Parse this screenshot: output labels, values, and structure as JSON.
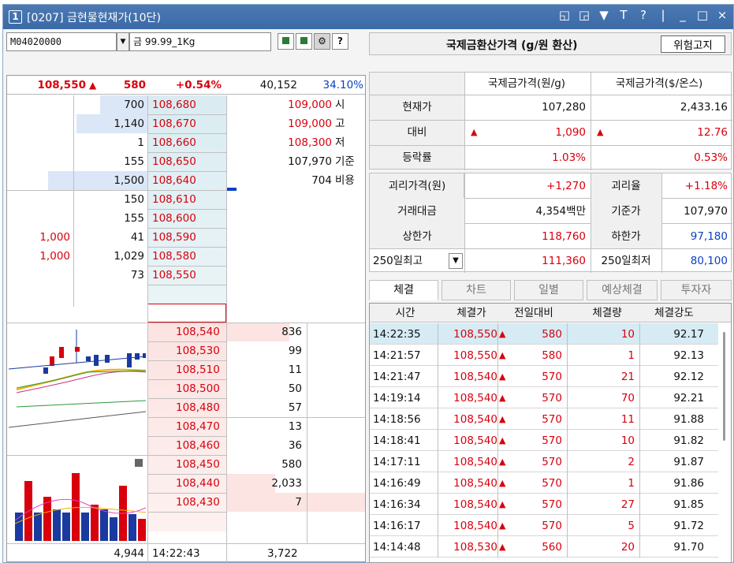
{
  "window": {
    "number": "1",
    "title": "[0207] 금현물현재가(10단)",
    "title_icons": [
      "restore-icon",
      "new-window-icon",
      "pin-icon",
      "text-icon",
      "help-icon",
      "separator",
      "minimize-icon",
      "maximize-icon",
      "close-icon"
    ],
    "title_icon_glyphs": [
      "◱",
      "◲",
      "▼",
      "T",
      "?",
      "|",
      "_",
      "□",
      "×"
    ]
  },
  "controls": {
    "code": "M04020000",
    "name": "금 99.99_1Kg",
    "icons": [
      "chart-small-icon",
      "chart-small-icon-2",
      "gear-icon",
      "help-icon"
    ],
    "icon_glyphs": [
      "▪",
      "▪",
      "⚙",
      "?"
    ]
  },
  "summary": {
    "price": "108,550",
    "change": "580",
    "change_pct": "+0.54%",
    "volume": "40,152",
    "rate": "34.10%"
  },
  "asks": [
    {
      "qty": "700",
      "price": "108,680"
    },
    {
      "qty": "1,140",
      "price": "108,670"
    },
    {
      "qty": "1",
      "price": "108,660"
    },
    {
      "qty": "155",
      "price": "108,650"
    },
    {
      "qty": "1,500",
      "price": "108,640"
    },
    {
      "qty": "150",
      "price": "108,610"
    },
    {
      "qty": "155",
      "price": "108,600"
    },
    {
      "qty": "41",
      "price": "108,590",
      "side": "1,000"
    },
    {
      "qty": "1,029",
      "price": "108,580",
      "side": "1,000"
    },
    {
      "qty": "73",
      "price": "108,550"
    }
  ],
  "ask_info": [
    {
      "value": "109,000",
      "label": "시"
    },
    {
      "value": "109,000",
      "label": "고"
    },
    {
      "value": "108,300",
      "label": "저"
    },
    {
      "value": "107,970",
      "label": "기준"
    },
    {
      "value": "704",
      "label": "비용"
    }
  ],
  "bids": [
    {
      "price": "108,540",
      "qty": "836"
    },
    {
      "price": "108,530",
      "qty": "99"
    },
    {
      "price": "108,510",
      "qty": "11"
    },
    {
      "price": "108,500",
      "qty": "50"
    },
    {
      "price": "108,480",
      "qty": "57"
    },
    {
      "price": "108,470",
      "qty": "13"
    },
    {
      "price": "108,460",
      "qty": "36"
    },
    {
      "price": "108,450",
      "qty": "580"
    },
    {
      "price": "108,440",
      "qty": "2,033"
    },
    {
      "price": "108,430",
      "qty": "7"
    }
  ],
  "footer": {
    "ask_total": "4,944",
    "time": "14:22:43",
    "bid_total": "3,722"
  },
  "intl": {
    "title": "국제금환산가격 (g/원 환산)",
    "risk_button": "위험고지",
    "col_krw": "국제금가격(원/g)",
    "col_usd": "국제금가격($/온스)",
    "rows": [
      {
        "label": "현재가",
        "krw": "107,280",
        "usd": "2,433.16"
      },
      {
        "label": "대비",
        "krw": "1,090",
        "usd": "12.76"
      },
      {
        "label": "등락률",
        "krw": "1.03%",
        "usd": "0.53%"
      }
    ]
  },
  "stats": {
    "gap_price_label": "괴리가격(원)",
    "gap_price": "+1,270",
    "gap_rate_label": "괴리율",
    "gap_rate": "+1.18%",
    "amount_label": "거래대금",
    "amount": "4,354백만",
    "base_label": "기준가",
    "base": "107,970",
    "upper_label": "상한가",
    "upper": "118,760",
    "lower_label": "하한가",
    "lower": "97,180",
    "high250_label": "250일최고",
    "high250": "111,360",
    "low250_label": "250일최저",
    "low250": "80,100"
  },
  "tabs": [
    "체결",
    "차트",
    "일별",
    "예상체결",
    "투자자"
  ],
  "trades": {
    "headers": [
      "시간",
      "체결가",
      "전일대비",
      "체결량",
      "체결강도"
    ],
    "rows": [
      {
        "time": "14:22:35",
        "price": "108,550",
        "diff": "580",
        "qty": "10",
        "strength": "92.17"
      },
      {
        "time": "14:21:57",
        "price": "108,550",
        "diff": "580",
        "qty": "1",
        "strength": "92.13"
      },
      {
        "time": "14:21:47",
        "price": "108,540",
        "diff": "570",
        "qty": "21",
        "strength": "92.12"
      },
      {
        "time": "14:19:14",
        "price": "108,540",
        "diff": "570",
        "qty": "70",
        "strength": "92.21"
      },
      {
        "time": "14:18:56",
        "price": "108,540",
        "diff": "570",
        "qty": "11",
        "strength": "91.88"
      },
      {
        "time": "14:18:41",
        "price": "108,540",
        "diff": "570",
        "qty": "10",
        "strength": "91.82"
      },
      {
        "time": "14:17:11",
        "price": "108,540",
        "diff": "570",
        "qty": "2",
        "strength": "91.87"
      },
      {
        "time": "14:16:49",
        "price": "108,540",
        "diff": "570",
        "qty": "1",
        "strength": "91.86"
      },
      {
        "time": "14:16:34",
        "price": "108,540",
        "diff": "570",
        "qty": "27",
        "strength": "91.85"
      },
      {
        "time": "14:16:17",
        "price": "108,540",
        "diff": "570",
        "qty": "5",
        "strength": "91.72"
      },
      {
        "time": "14:14:48",
        "price": "108,530",
        "diff": "560",
        "qty": "20",
        "strength": "91.70"
      }
    ]
  },
  "colors": {
    "up": "#d8000c",
    "down": "#0a3fc4",
    "titlebar": "#3b6aa6"
  }
}
